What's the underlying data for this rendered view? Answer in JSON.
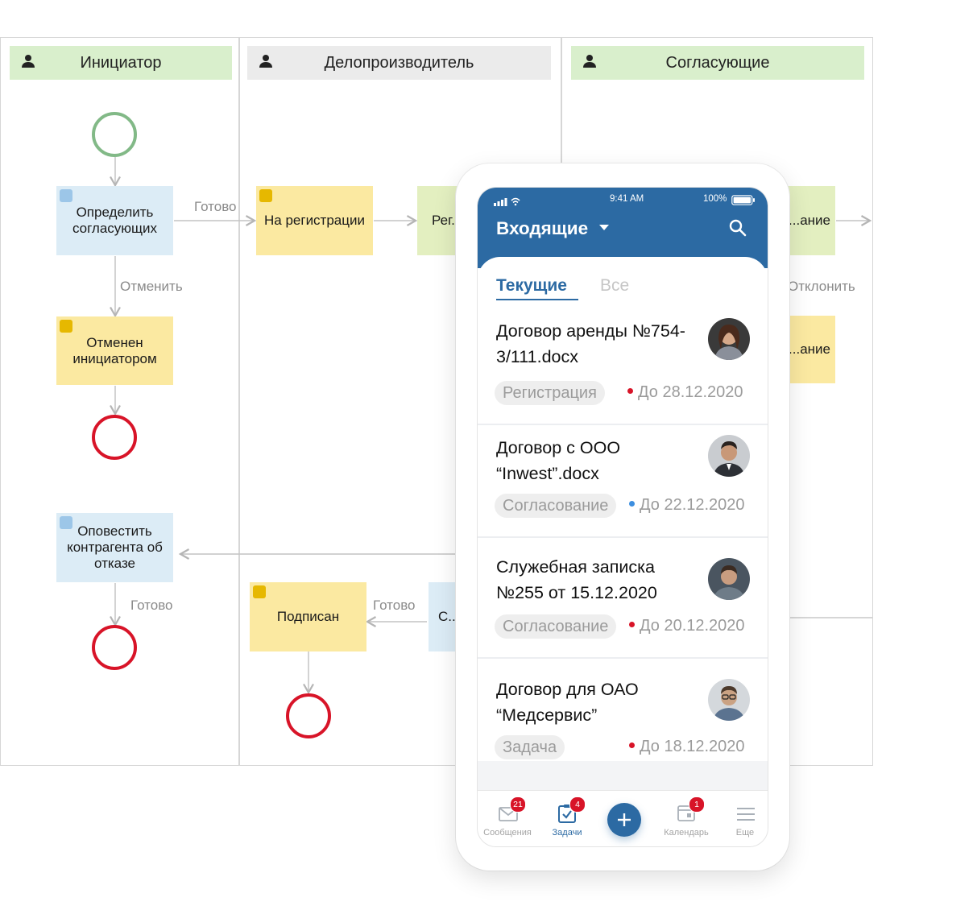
{
  "lanes": [
    {
      "title": "Инициатор"
    },
    {
      "title": "Делопроизводитель"
    },
    {
      "title": "Согласующие"
    }
  ],
  "tasks": {
    "define": "Определить согласующих",
    "registration": "На регистрации",
    "reg_doc": "Рег... док...",
    "cancelled": "Отменен инициатором",
    "notify": "Оповестить контрагента об отказе",
    "signed": "Подписан",
    "partial_c": "С... по...",
    "right_top": "...ание",
    "right_mid": "...ание"
  },
  "flows": {
    "ready1": "Готово",
    "cancel": "Отменить",
    "reject": "Отклонить",
    "ready2": "Готово",
    "ready3": "Готово"
  },
  "phone": {
    "status": {
      "time": "9:41 AM",
      "battery": "100%"
    },
    "title": "Входящие",
    "tabs": [
      "Текущие",
      "Все"
    ],
    "cards": [
      {
        "title": "Договор аренды №754-3/111.docx",
        "tag": "Регистрация",
        "due": "До 28.12.2020",
        "dot_color": "#d81428"
      },
      {
        "title": "Договор с ООО “Inwest”.docx",
        "tag": "Согласование",
        "due": "До 22.12.2020",
        "dot_color": "#3d8fe0"
      },
      {
        "title": "Служебная записка №255 от 15.12.2020",
        "tag": "Согласование",
        "due": "До 20.12.2020",
        "dot_color": "#d81428"
      },
      {
        "title": "Договор для ОАО “Медсервис”",
        "tag": "Задача",
        "due": "До 18.12.2020",
        "dot_color": "#d81428"
      }
    ],
    "nav": [
      {
        "label": "Сообщения",
        "badge": "21",
        "icon": "envelope-icon"
      },
      {
        "label": "Задачи",
        "badge": "4",
        "icon": "task-check-icon"
      },
      {
        "label": "",
        "badge": "",
        "icon": "plus-icon"
      },
      {
        "label": "Календарь",
        "badge": "1",
        "icon": "calendar-icon"
      },
      {
        "label": "Еще",
        "badge": "",
        "icon": "menu-icon"
      }
    ]
  },
  "colors": {
    "accent": "#2c6aa3",
    "end_event": "#d81428",
    "start_event": "#82b987"
  }
}
